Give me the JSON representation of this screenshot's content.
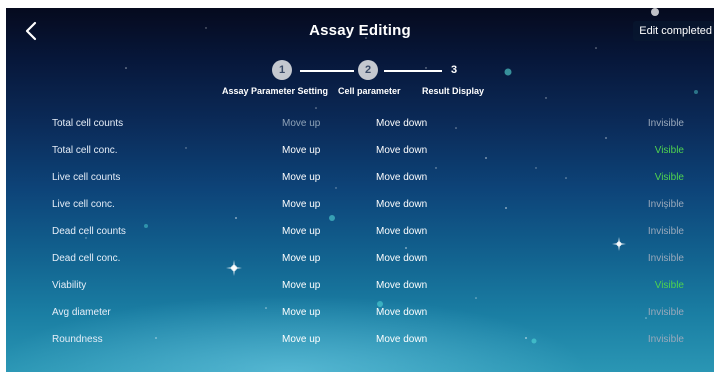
{
  "header": {
    "title": "Assay Editing",
    "edit_label": "Edit completed"
  },
  "stepper": {
    "steps": [
      {
        "number": "1",
        "label": "Assay Parameter Setting",
        "state": "done"
      },
      {
        "number": "2",
        "label": "Cell parameter",
        "state": "done"
      },
      {
        "number": "3",
        "label": "Result Display",
        "state": "current"
      }
    ]
  },
  "rows": [
    {
      "name": "Total cell counts",
      "up": "Move up",
      "down": "Move down",
      "visibility": "Invisible",
      "up_disabled": true
    },
    {
      "name": "Total cell conc.",
      "up": "Move up",
      "down": "Move down",
      "visibility": "Visible"
    },
    {
      "name": "Live cell counts",
      "up": "Move up",
      "down": "Move down",
      "visibility": "Visible"
    },
    {
      "name": "Live cell conc.",
      "up": "Move up",
      "down": "Move down",
      "visibility": "Invisible"
    },
    {
      "name": "Dead cell counts",
      "up": "Move up",
      "down": "Move down",
      "visibility": "Invisible"
    },
    {
      "name": "Dead cell conc.",
      "up": "Move up",
      "down": "Move down",
      "visibility": "Invisible"
    },
    {
      "name": "Viability",
      "up": "Move up",
      "down": "Move down",
      "visibility": "Visible"
    },
    {
      "name": "Avg diameter",
      "up": "Move up",
      "down": "Move down",
      "visibility": "Invisible"
    },
    {
      "name": "Roundness",
      "up": "Move up",
      "down": "Move down",
      "visibility": "Invisible"
    }
  ],
  "colors": {
    "visible": "#4fd34f",
    "invisible": "#9aa9bb",
    "disabled": "#8fa3b8"
  }
}
